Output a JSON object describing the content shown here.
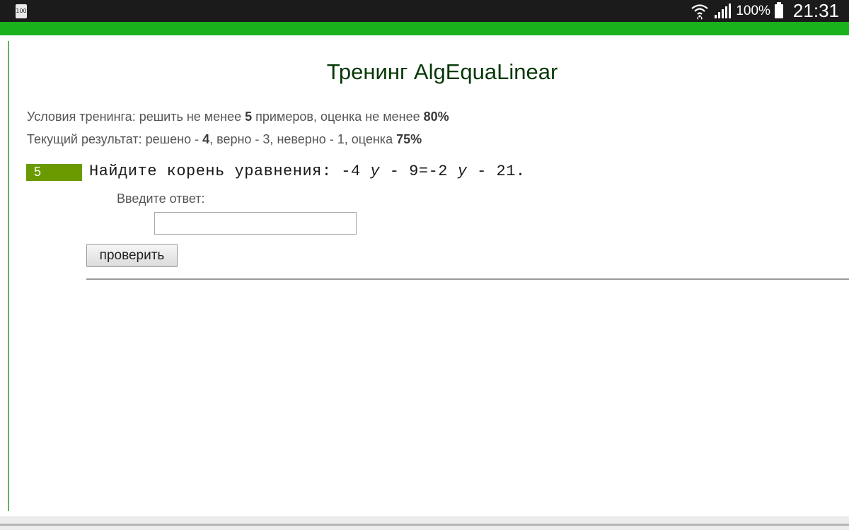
{
  "status_bar": {
    "battery_badge": "100",
    "battery_percent": "100%",
    "clock": "21:31",
    "icons": [
      "wifi-icon",
      "signal-icon",
      "battery-icon"
    ]
  },
  "page": {
    "title": "Тренинг AlgEquaLinear"
  },
  "conditions": {
    "prefix": "Условия тренинга: решить не менее ",
    "min_examples": "5",
    "middle": " примеров, оценка не менее ",
    "min_score": "80%"
  },
  "result": {
    "prefix": "Текущий результат: решено - ",
    "solved": "4",
    "correct_part": ", верно - 3, неверно - 1, оценка ",
    "score": "75%"
  },
  "task": {
    "number": "5",
    "text_before": "Найдите корень уравнения: -4 ",
    "var1": "y",
    "text_mid": " - 9=-2 ",
    "var2": "y",
    "text_after": " - 21."
  },
  "answer": {
    "label": "Введите ответ:",
    "value": "",
    "placeholder": ""
  },
  "check_button": {
    "label": "проверить"
  },
  "colors": {
    "status_bar": "#1b1b1b",
    "accent_green": "#1ab21a",
    "badge_green": "#6a9a00",
    "title_green": "#063806"
  }
}
